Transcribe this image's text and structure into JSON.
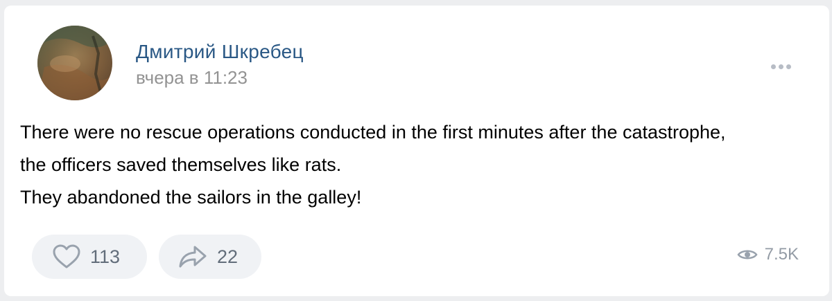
{
  "post": {
    "author": "Дмитрий Шкребец",
    "time": "вчера в 11:23",
    "text_lines": [
      "There were no rescue operations conducted in the first minutes after the catastrophe,",
      "the officers saved themselves like rats.",
      "They abandoned the sailors in the galley!"
    ]
  },
  "actions": {
    "likes": "113",
    "shares": "22",
    "views": "7.5K"
  },
  "icons": {
    "like": "heart-icon",
    "share": "share-arrow-icon",
    "views": "eye-icon",
    "more": "more-dots-icon"
  },
  "colors": {
    "author": "#2a5885",
    "secondary": "#939393",
    "button_bg": "#f0f2f5",
    "icon": "#99a2ad"
  }
}
